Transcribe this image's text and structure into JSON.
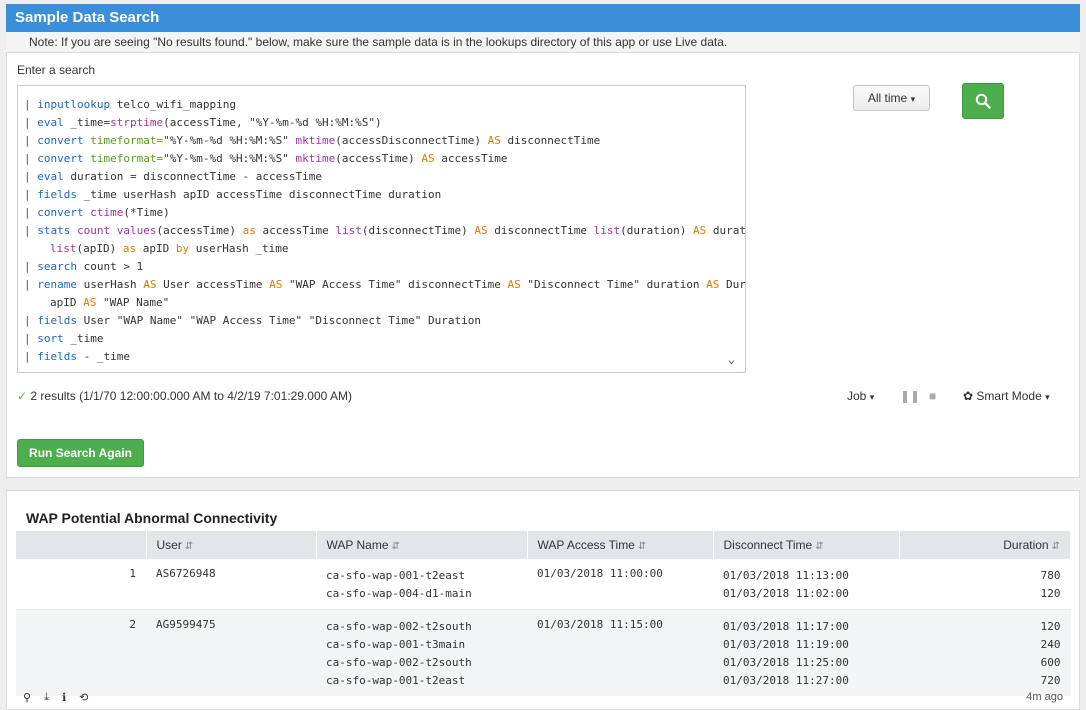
{
  "header": {
    "title": "Sample Data Search"
  },
  "note": "Note: If you are seeing \"No results found.\" below, make sure the sample data is in the lookups directory of this app or use Live data.",
  "search": {
    "label": "Enter a search",
    "time_range": "All time",
    "results_summary": "2 results (1/1/70 12:00:00.000 AM to 4/2/19 7:01:29.000 AM)",
    "job_label": "Job",
    "mode_label": "Smart Mode",
    "run_again_label": "Run Search Again"
  },
  "query_lines": [
    "| inputlookup telco_wifi_mapping",
    "| eval _time=strptime(accessTime, \"%Y-%m-%d %H:%M:%S\")",
    "| convert timeformat=\"%Y-%m-%d %H:%M:%S\" mktime(accessDisconnectTime) AS disconnectTime",
    "| convert timeformat=\"%Y-%m-%d %H:%M:%S\" mktime(accessTime) AS accessTime",
    "| eval duration = disconnectTime - accessTime",
    "| fields _time userHash apID accessTime disconnectTime duration",
    "| convert ctime(*Time)",
    "| stats count values(accessTime) as accessTime list(disconnectTime) AS disconnectTime list(duration) AS duration",
    "list(apID) as apID by userHash _time",
    "| search count > 1",
    "| rename userHash AS User accessTime AS \"WAP Access Time\" disconnectTime AS \"Disconnect Time\" duration AS Duration",
    "apID AS \"WAP Name\"",
    "| fields User \"WAP Name\" \"WAP Access Time\" \"Disconnect Time\" Duration",
    "| sort _time",
    "| fields - _time"
  ],
  "results_panel": {
    "title": "WAP Potential Abnormal Connectivity",
    "columns": [
      "",
      "User",
      "WAP Name",
      "WAP Access Time",
      "Disconnect Time",
      "Duration"
    ],
    "rows": [
      {
        "index": "1",
        "user": "AS6726948",
        "wap_names": [
          "ca-sfo-wap-001-t2east",
          "ca-sfo-wap-004-d1-main"
        ],
        "access_time": "01/03/2018 11:00:00",
        "disconnect_times": [
          "01/03/2018 11:13:00",
          "01/03/2018 11:02:00"
        ],
        "durations": [
          "780",
          "120"
        ]
      },
      {
        "index": "2",
        "user": "AG9599475",
        "wap_names": [
          "ca-sfo-wap-002-t2south",
          "ca-sfo-wap-001-t3main",
          "ca-sfo-wap-002-t2south",
          "ca-sfo-wap-001-t2east"
        ],
        "access_time": "01/03/2018 11:15:00",
        "disconnect_times": [
          "01/03/2018 11:17:00",
          "01/03/2018 11:19:00",
          "01/03/2018 11:25:00",
          "01/03/2018 11:27:00"
        ],
        "durations": [
          "120",
          "240",
          "600",
          "720"
        ]
      }
    ],
    "footer_age": "4m ago"
  },
  "icons": {
    "search": "magnifier-icon",
    "export": "download-icon",
    "inspect": "info-icon",
    "refresh": "refresh-icon"
  },
  "colors": {
    "header_bg": "#3b8fd8",
    "accent_green": "#4cae4c"
  }
}
